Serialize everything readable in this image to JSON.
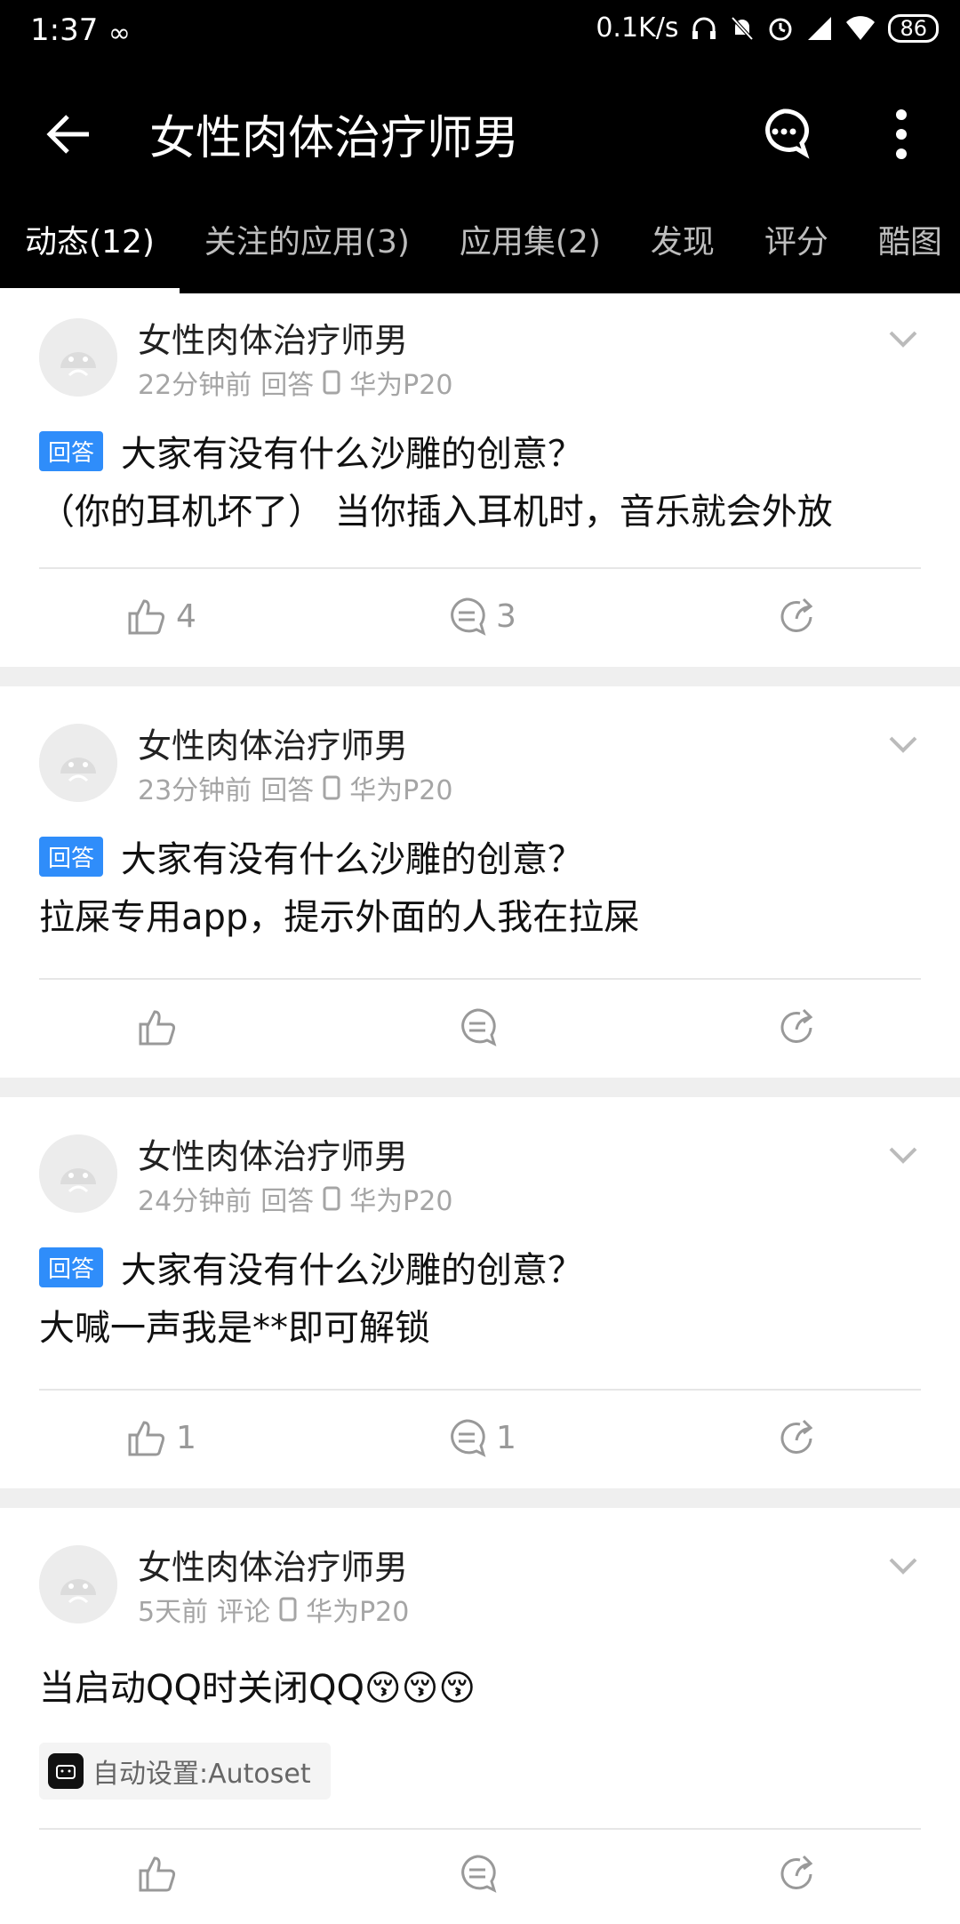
{
  "status_bar": {
    "time": "1:37",
    "inf_symbol": "∞",
    "net_speed": "0.1K/s",
    "battery": "86"
  },
  "header": {
    "title": "女性肉体治疗师男"
  },
  "tabs": [
    {
      "label": "动态(12)",
      "active": true
    },
    {
      "label": "关注的应用(3)",
      "active": false
    },
    {
      "label": "应用集(2)",
      "active": false
    },
    {
      "label": "发现",
      "active": false
    },
    {
      "label": "评分",
      "active": false
    },
    {
      "label": "酷图",
      "active": false
    }
  ],
  "posts": [
    {
      "user": "女性肉体治疗师男",
      "time": "22分钟前",
      "type": "回答",
      "device": "华为P20",
      "badge": "回答",
      "question": "大家有没有什么沙雕的创意？",
      "body": "（你的耳机坏了） 当你插入耳机时，音乐就会外放",
      "likes": "4",
      "comments": "3"
    },
    {
      "user": "女性肉体治疗师男",
      "time": "23分钟前",
      "type": "回答",
      "device": "华为P20",
      "badge": "回答",
      "question": "大家有没有什么沙雕的创意？",
      "body": "拉屎专用app，提示外面的人我在拉屎",
      "likes": "",
      "comments": ""
    },
    {
      "user": "女性肉体治疗师男",
      "time": "24分钟前",
      "type": "回答",
      "device": "华为P20",
      "badge": "回答",
      "question": "大家有没有什么沙雕的创意？",
      "body": "大喊一声我是**即可解锁",
      "likes": "1",
      "comments": "1"
    },
    {
      "user": "女性肉体治疗师男",
      "time": "5天前",
      "type": "评论",
      "device": "华为P20",
      "body": "当启动QQ时关闭QQ😚😚😚",
      "app_tag": "自动设置:Autoset"
    }
  ],
  "colors": {
    "badge": "#2f8dfa",
    "header_bg": "#000000",
    "separator": "#efefef"
  }
}
